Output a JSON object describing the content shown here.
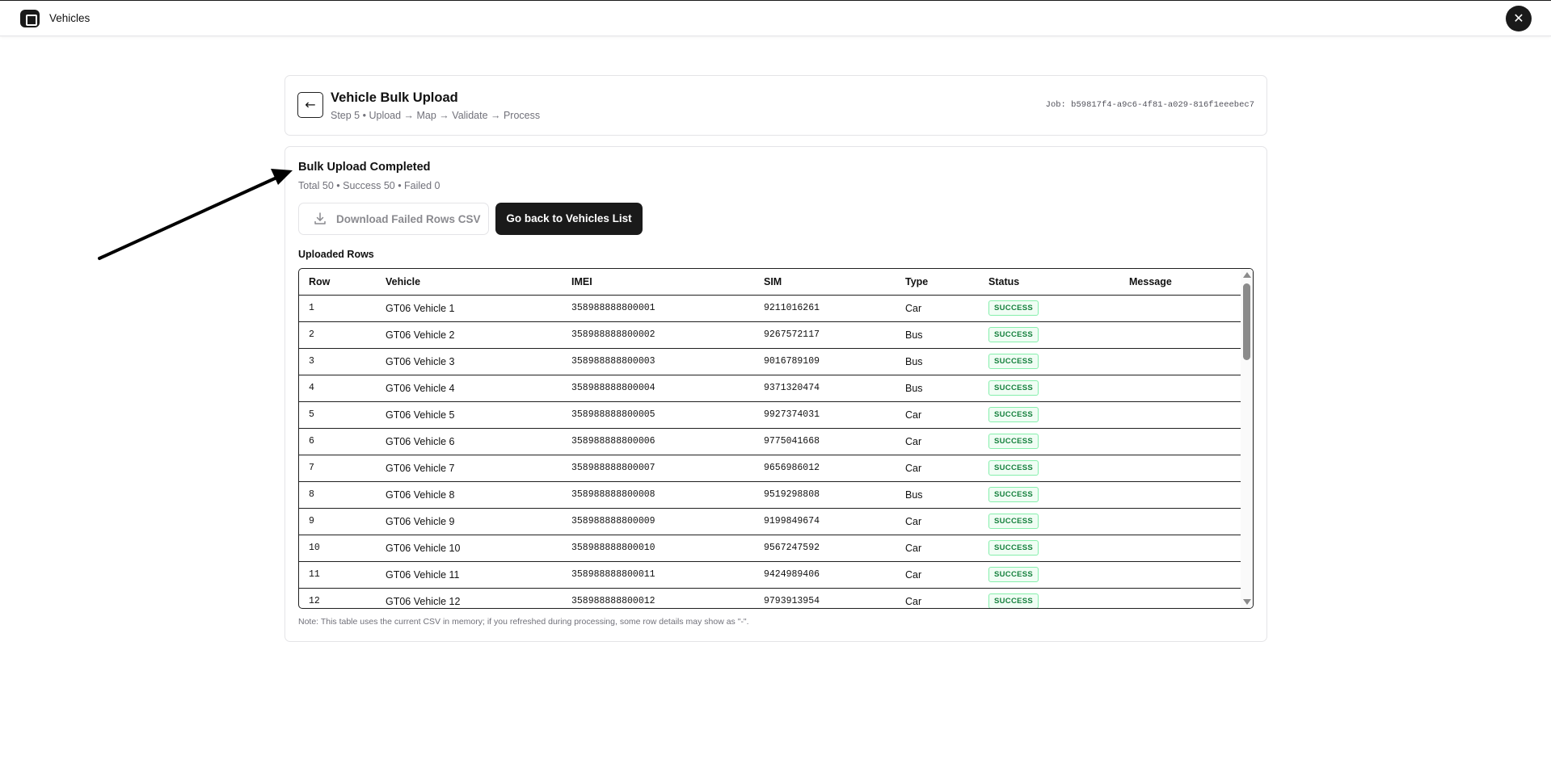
{
  "app": {
    "title": "Vehicles",
    "icon": "square-app-icon",
    "close_icon": "close-icon"
  },
  "header": {
    "title": "Vehicle Bulk Upload",
    "subtitle": "Step 5 • Upload → Map → Validate → Process",
    "job": "Job: b59817f4-a9c6-4f81-a029-816f1eeebec7",
    "back_icon": "arrow-left-icon"
  },
  "result": {
    "title": "Bulk Upload Completed",
    "summary": "Total 50 • Success 50 • Failed 0",
    "download_label": "Download Failed Rows CSV",
    "download_icon": "download-icon",
    "back_label": "Go back to Vehicles List",
    "rows_label": "Uploaded Rows"
  },
  "table": {
    "columns": [
      "Row",
      "Vehicle",
      "IMEI",
      "SIM",
      "Type",
      "Status",
      "Message"
    ],
    "rows": [
      {
        "row": "1",
        "vehicle": "GT06 Vehicle 1",
        "imei": "358988888800001",
        "sim": "9211016261",
        "type": "Car",
        "status": "SUCCESS",
        "message": ""
      },
      {
        "row": "2",
        "vehicle": "GT06 Vehicle 2",
        "imei": "358988888800002",
        "sim": "9267572117",
        "type": "Bus",
        "status": "SUCCESS",
        "message": ""
      },
      {
        "row": "3",
        "vehicle": "GT06 Vehicle 3",
        "imei": "358988888800003",
        "sim": "9016789109",
        "type": "Bus",
        "status": "SUCCESS",
        "message": ""
      },
      {
        "row": "4",
        "vehicle": "GT06 Vehicle 4",
        "imei": "358988888800004",
        "sim": "9371320474",
        "type": "Bus",
        "status": "SUCCESS",
        "message": ""
      },
      {
        "row": "5",
        "vehicle": "GT06 Vehicle 5",
        "imei": "358988888800005",
        "sim": "9927374031",
        "type": "Car",
        "status": "SUCCESS",
        "message": ""
      },
      {
        "row": "6",
        "vehicle": "GT06 Vehicle 6",
        "imei": "358988888800006",
        "sim": "9775041668",
        "type": "Car",
        "status": "SUCCESS",
        "message": ""
      },
      {
        "row": "7",
        "vehicle": "GT06 Vehicle 7",
        "imei": "358988888800007",
        "sim": "9656986012",
        "type": "Car",
        "status": "SUCCESS",
        "message": ""
      },
      {
        "row": "8",
        "vehicle": "GT06 Vehicle 8",
        "imei": "358988888800008",
        "sim": "9519298808",
        "type": "Bus",
        "status": "SUCCESS",
        "message": ""
      },
      {
        "row": "9",
        "vehicle": "GT06 Vehicle 9",
        "imei": "358988888800009",
        "sim": "9199849674",
        "type": "Car",
        "status": "SUCCESS",
        "message": ""
      },
      {
        "row": "10",
        "vehicle": "GT06 Vehicle 10",
        "imei": "358988888800010",
        "sim": "9567247592",
        "type": "Car",
        "status": "SUCCESS",
        "message": ""
      },
      {
        "row": "11",
        "vehicle": "GT06 Vehicle 11",
        "imei": "358988888800011",
        "sim": "9424989406",
        "type": "Car",
        "status": "SUCCESS",
        "message": ""
      },
      {
        "row": "12",
        "vehicle": "GT06 Vehicle 12",
        "imei": "358988888800012",
        "sim": "9793913954",
        "type": "Car",
        "status": "SUCCESS",
        "message": ""
      }
    ]
  },
  "note": "Note: This table uses the current CSV in memory; if you refreshed during processing, some row details may show as \"-\".",
  "colors": {
    "primary": "#1a1a1a",
    "success_text": "#15803d",
    "success_bg": "#f0fdf4",
    "success_border": "#86efac",
    "muted": "#71717a"
  }
}
